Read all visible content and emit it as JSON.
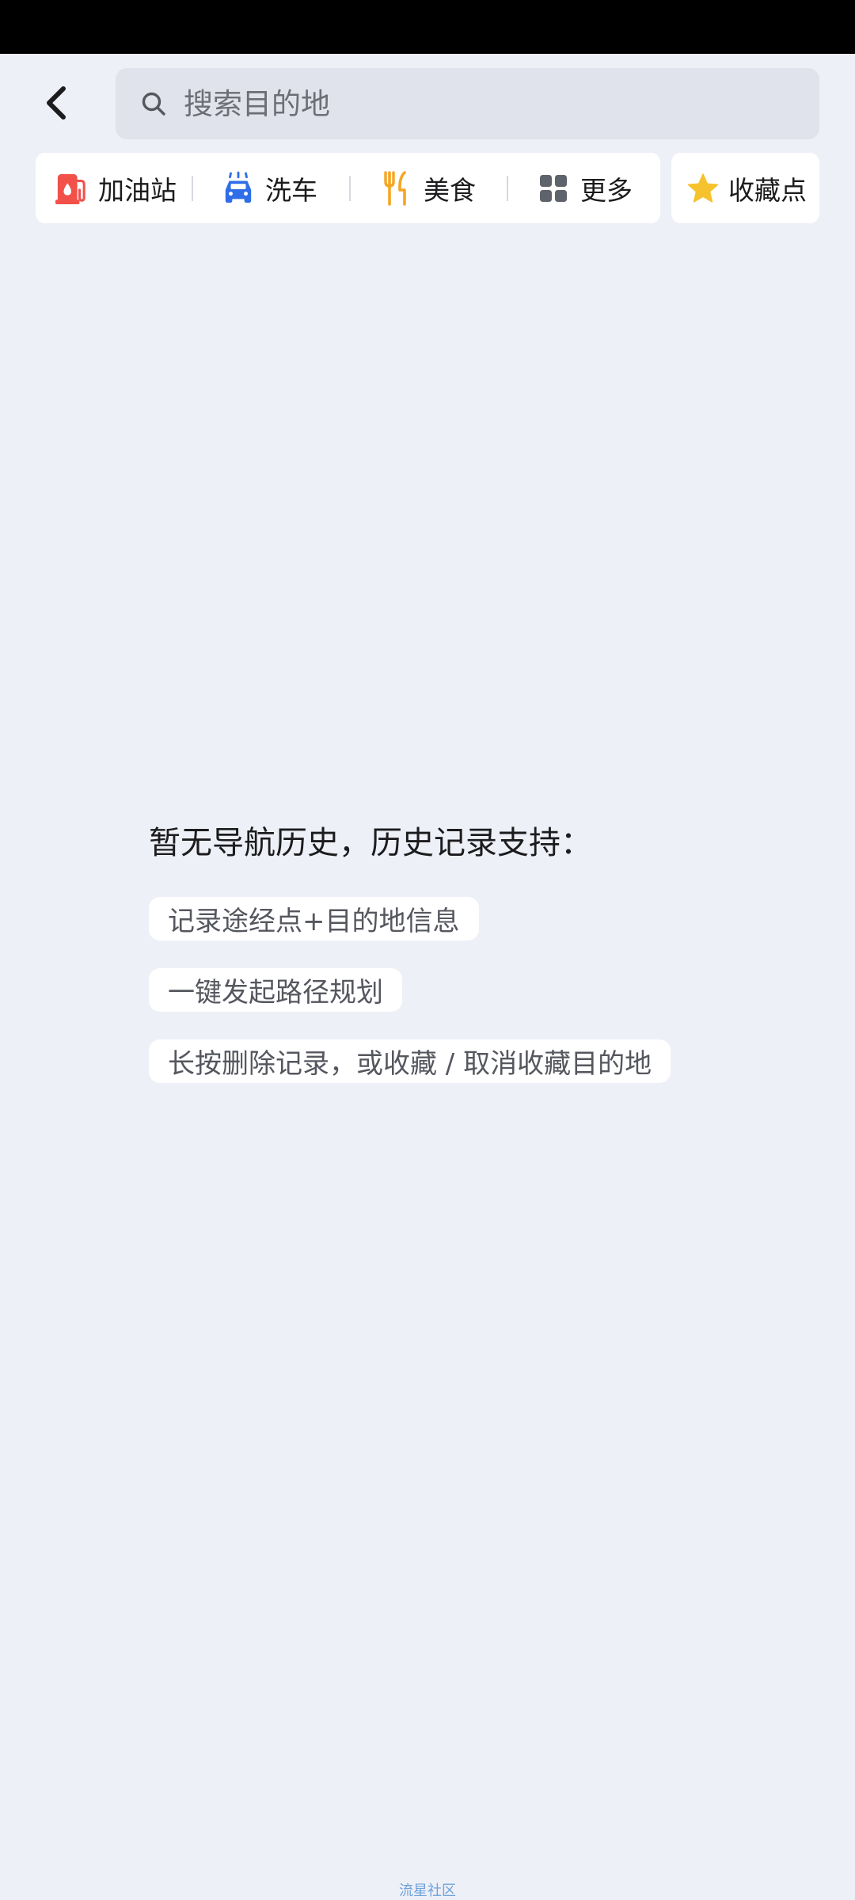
{
  "header": {
    "back_icon": "chevron-left-icon",
    "search": {
      "placeholder": "搜索目的地",
      "value": "",
      "icon": "search-icon"
    }
  },
  "categories": [
    {
      "label": "加油站",
      "icon": "gas-station-icon",
      "color": "#f2514a"
    },
    {
      "label": "洗车",
      "icon": "car-wash-icon",
      "color": "#2f6ee8"
    },
    {
      "label": "美食",
      "icon": "fork-knife-icon",
      "color": "#f5a623"
    },
    {
      "label": "更多",
      "icon": "grid-icon",
      "color": "#5f636b"
    }
  ],
  "favorites": {
    "label": "收藏点",
    "icon": "star-icon",
    "color": "#f6c22d"
  },
  "empty_state": {
    "title": "暂无导航历史，历史记录支持：",
    "features": [
      "记录途经点+目的地信息",
      "一键发起路径规划",
      "长按删除记录，或收藏 / 取消收藏目的地"
    ]
  },
  "watermark": "流星社区",
  "colors": {
    "background": "#eef0f7",
    "search_bg": "#e1e3ec",
    "card_bg": "#ffffff",
    "watermark": "#6ea2d8"
  }
}
